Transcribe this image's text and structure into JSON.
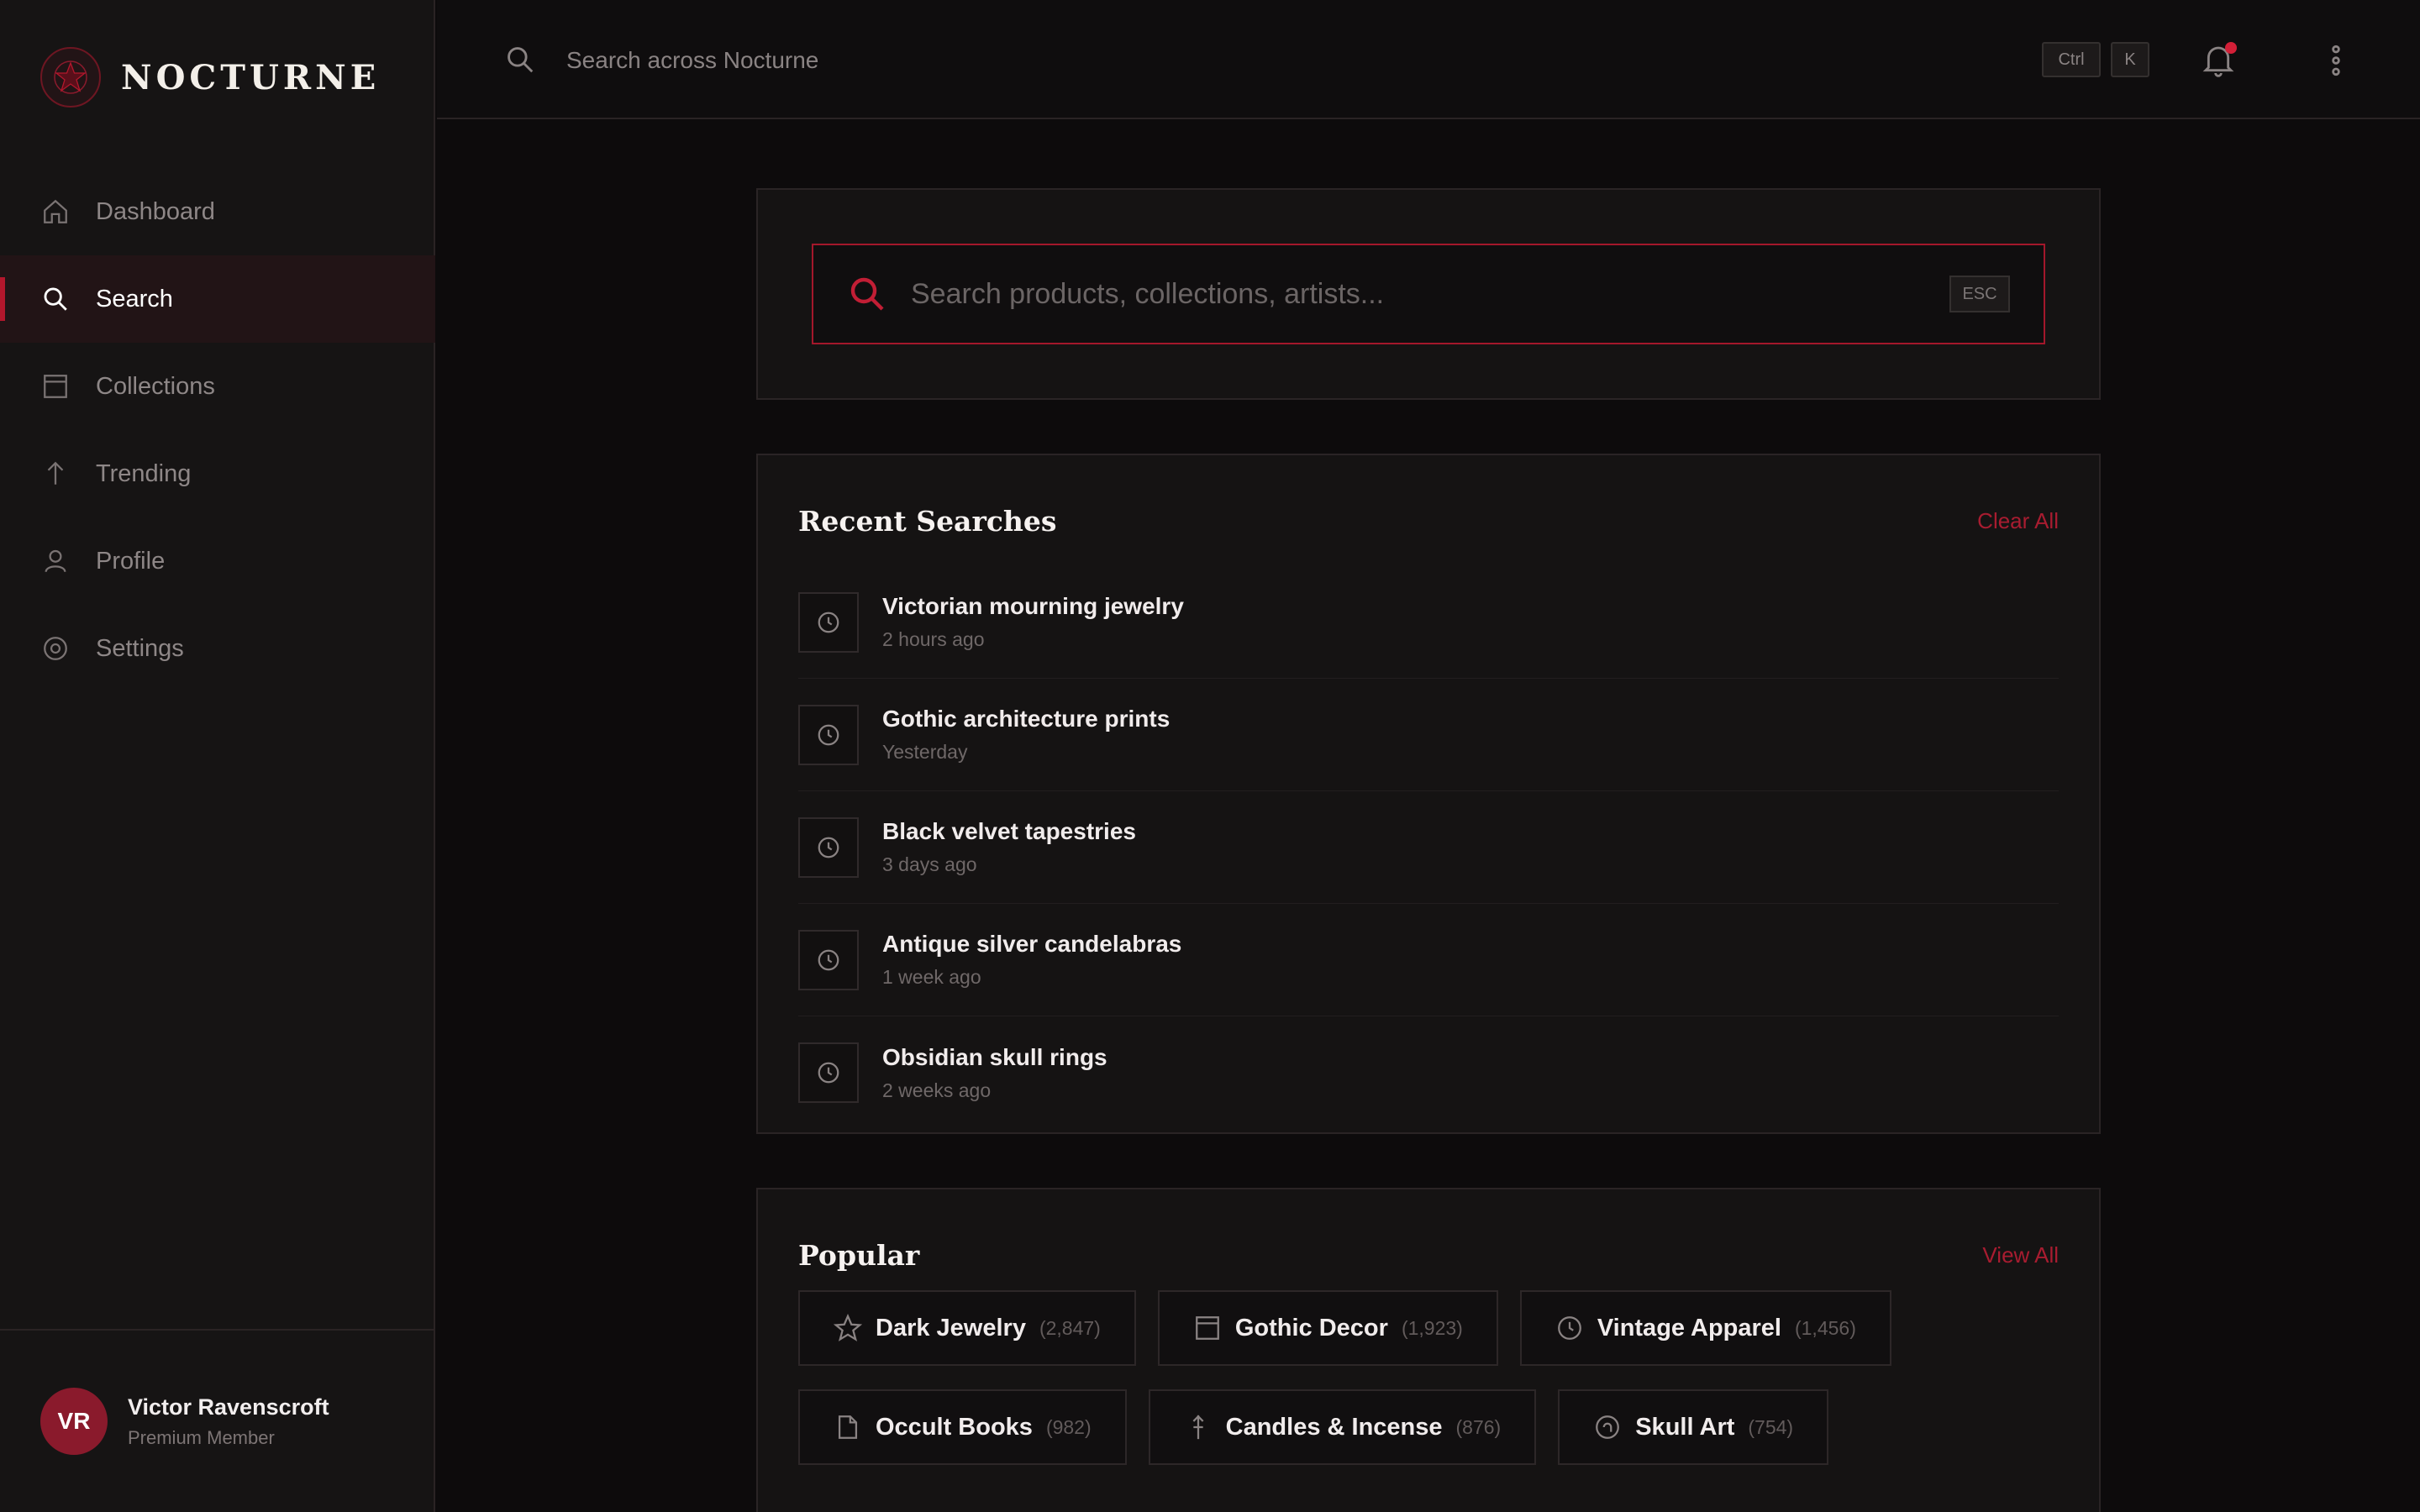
{
  "brand": {
    "name": "NOCTURNE"
  },
  "nav": {
    "items": [
      {
        "label": "Dashboard",
        "icon": "home-icon"
      },
      {
        "label": "Search",
        "icon": "search-icon"
      },
      {
        "label": "Collections",
        "icon": "collection-icon"
      },
      {
        "label": "Trending",
        "icon": "arrow-up-icon"
      },
      {
        "label": "Profile",
        "icon": "user-icon"
      },
      {
        "label": "Settings",
        "icon": "gear-icon"
      }
    ],
    "active": "Search"
  },
  "user": {
    "initials": "VR",
    "name": "Victor Ravenscroft",
    "role": "Premium Member"
  },
  "topbar": {
    "search_placeholder": "Search across Nocturne",
    "shortcut_ctrl": "Ctrl",
    "shortcut_key": "K"
  },
  "search": {
    "placeholder": "Search products, collections, artists...",
    "esc_label": "ESC"
  },
  "recent": {
    "title": "Recent Searches",
    "clear_label": "Clear All",
    "items": [
      {
        "title": "Victorian mourning jewelry",
        "time": "2 hours ago"
      },
      {
        "title": "Gothic architecture prints",
        "time": "Yesterday"
      },
      {
        "title": "Black velvet tapestries",
        "time": "3 days ago"
      },
      {
        "title": "Antique silver candelabras",
        "time": "1 week ago"
      },
      {
        "title": "Obsidian skull rings",
        "time": "2 weeks ago"
      }
    ]
  },
  "popular": {
    "title": "Popular",
    "view_all_label": "View All",
    "chips": [
      {
        "label": "Dark Jewelry",
        "count": "(2,847)",
        "icon": "star-icon"
      },
      {
        "label": "Gothic Decor",
        "count": "(1,923)",
        "icon": "frame-icon"
      },
      {
        "label": "Vintage Apparel",
        "count": "(1,456)",
        "icon": "clock-icon"
      },
      {
        "label": "Occult Books",
        "count": "(982)",
        "icon": "book-icon"
      },
      {
        "label": "Candles & Incense",
        "count": "(876)",
        "icon": "candle-icon"
      },
      {
        "label": "Skull Art",
        "count": "(754)",
        "icon": "skull-icon"
      }
    ]
  },
  "colors": {
    "accent": "#b3172c",
    "background": "#0d0b0c",
    "sidebar": "#161414"
  }
}
